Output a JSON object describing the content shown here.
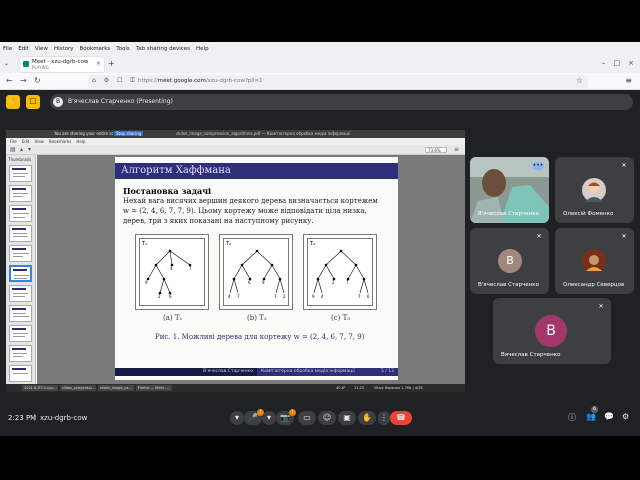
{
  "browser": {
    "menu": [
      "File",
      "Edit",
      "View",
      "History",
      "Bookmarks",
      "Tools",
      "Tab sharing devices",
      "Help"
    ],
    "tab": {
      "title": "Meet - xzu-dgrb-cow",
      "subtitle": "PLAYING",
      "close": "×"
    },
    "tab_list_icon": "⌄",
    "new_tab": "+",
    "window_controls": [
      "–",
      "□",
      "×"
    ],
    "back": "←",
    "forward": "→",
    "reload": "↻",
    "url_prefix": "https://",
    "url_domain": "meet.google.com",
    "url_path": "/xzu-dgrb-cow?pli=1",
    "url_icons": "⌂ ⚙ ☐ ⚿",
    "bookmark_icon": "☆",
    "menu_icon": "≡"
  },
  "meet_header": {
    "presenter_initial": "В",
    "presenter_label": "В'ячеслав Старченко (Presenting)",
    "icon1": "✋",
    "icon2": "☐"
  },
  "share": {
    "sharing_text": "You are sharing your entire screen",
    "stop_label": "Stop sharing",
    "doc_title": "slides_image_compression_algorithms.pdf — Компʼютерна обробка медіа інформації"
  },
  "pdf_viewer": {
    "menu": [
      "File",
      "Edit",
      "View",
      "Bookmarks",
      "Help"
    ],
    "zoom": "73.6%",
    "thumbs_header": "Thumbnails"
  },
  "slide": {
    "title": "Алгоритм Хаффмана",
    "subheading": "Постановка задачі",
    "lines": [
      "Нехай вага висячих вершин деякого дерева визначається кортежем",
      "w = (2, 4, 6, 7, 7, 9). Цьому кортежу може відповідати ціла низка,",
      "дерев, три з яких показані на наступному рисунку."
    ],
    "trees": [
      {
        "label": "T₁",
        "caption": "(a) T₁"
      },
      {
        "label": "T₂",
        "caption": "(b) T₂"
      },
      {
        "label": "T₃",
        "caption": "(c) T₃"
      }
    ],
    "figure_caption": "Рис. 1. Можливі дерева для кортежу w = (2, 4, 6, 7, 7, 9)",
    "footer_author": "В'ячеслав Старченко",
    "footer_course": "Компʼютерна обробка медіа інформації",
    "footer_page": "5 / 13"
  },
  "taskbar": {
    "items": [
      "2021 Б-ПЗ 4 кур...",
      "slides_compressi...",
      "slides_image_co...",
      "Firefox — Meet -..."
    ],
    "status_left": "40.8°",
    "status_mid": "11:25",
    "status_right": "Vitaly Ворочко 1.7Kb | 4/26"
  },
  "participants": [
    {
      "name": "В'ячеслав Старченко",
      "type": "video"
    },
    {
      "name": "Олексій Фоменко",
      "initial": "",
      "type": "photo"
    },
    {
      "name": "В'ячеслав Старченко",
      "initial": "В",
      "type": "initial",
      "color": "#a1887f"
    },
    {
      "name": "Олександр Северцов",
      "initial": "",
      "type": "photo2"
    },
    {
      "name": "Вячеслав Старченко",
      "initial": "В",
      "type": "initial",
      "color": "#a1376a"
    }
  ],
  "more_icon": "•••",
  "controls": {
    "time": "2:23 PM",
    "separator": "|",
    "meeting_code": "xzu-dgrb-cow",
    "mic_badge": "!",
    "cam_badge": "!",
    "people_count": "6",
    "icons": [
      "▾",
      "🎤",
      "▾",
      "📷",
      "▭",
      "☺",
      "▣",
      "✋",
      "⋮",
      "☎"
    ],
    "right_icons": [
      "ⓘ",
      "👥",
      "💬",
      "⚙"
    ]
  }
}
